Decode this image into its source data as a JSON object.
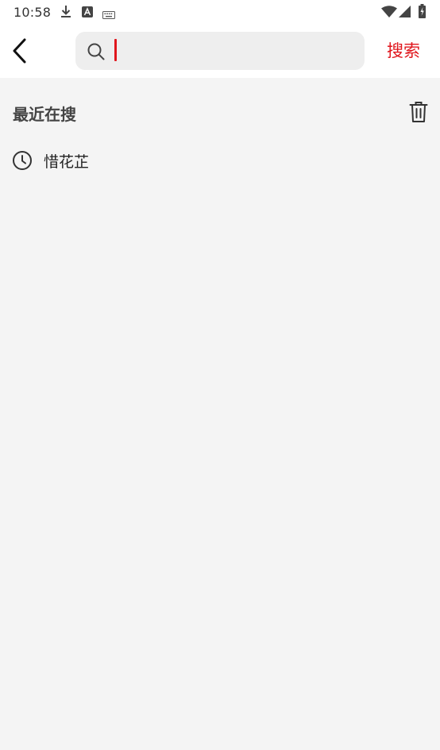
{
  "status_bar": {
    "time": "10:58",
    "icons": [
      "download-icon",
      "a-app-icon",
      "keyboard-icon",
      "wifi-icon",
      "signal-icon",
      "battery-icon"
    ]
  },
  "header": {
    "back_icon": "chevron-left-icon",
    "search": {
      "icon": "search-icon",
      "value": "",
      "placeholder": ""
    },
    "search_button_label": "搜索",
    "accent_color": "#e0161d"
  },
  "recent": {
    "title": "最近在搜",
    "clear_icon": "trash-icon",
    "items": [
      {
        "icon": "clock-icon",
        "label": "惜花芷"
      }
    ]
  },
  "colors": {
    "background": "#f4f4f4",
    "header_bg": "#ffffff",
    "search_bg": "#eeeeee",
    "accent": "#e0161d"
  }
}
